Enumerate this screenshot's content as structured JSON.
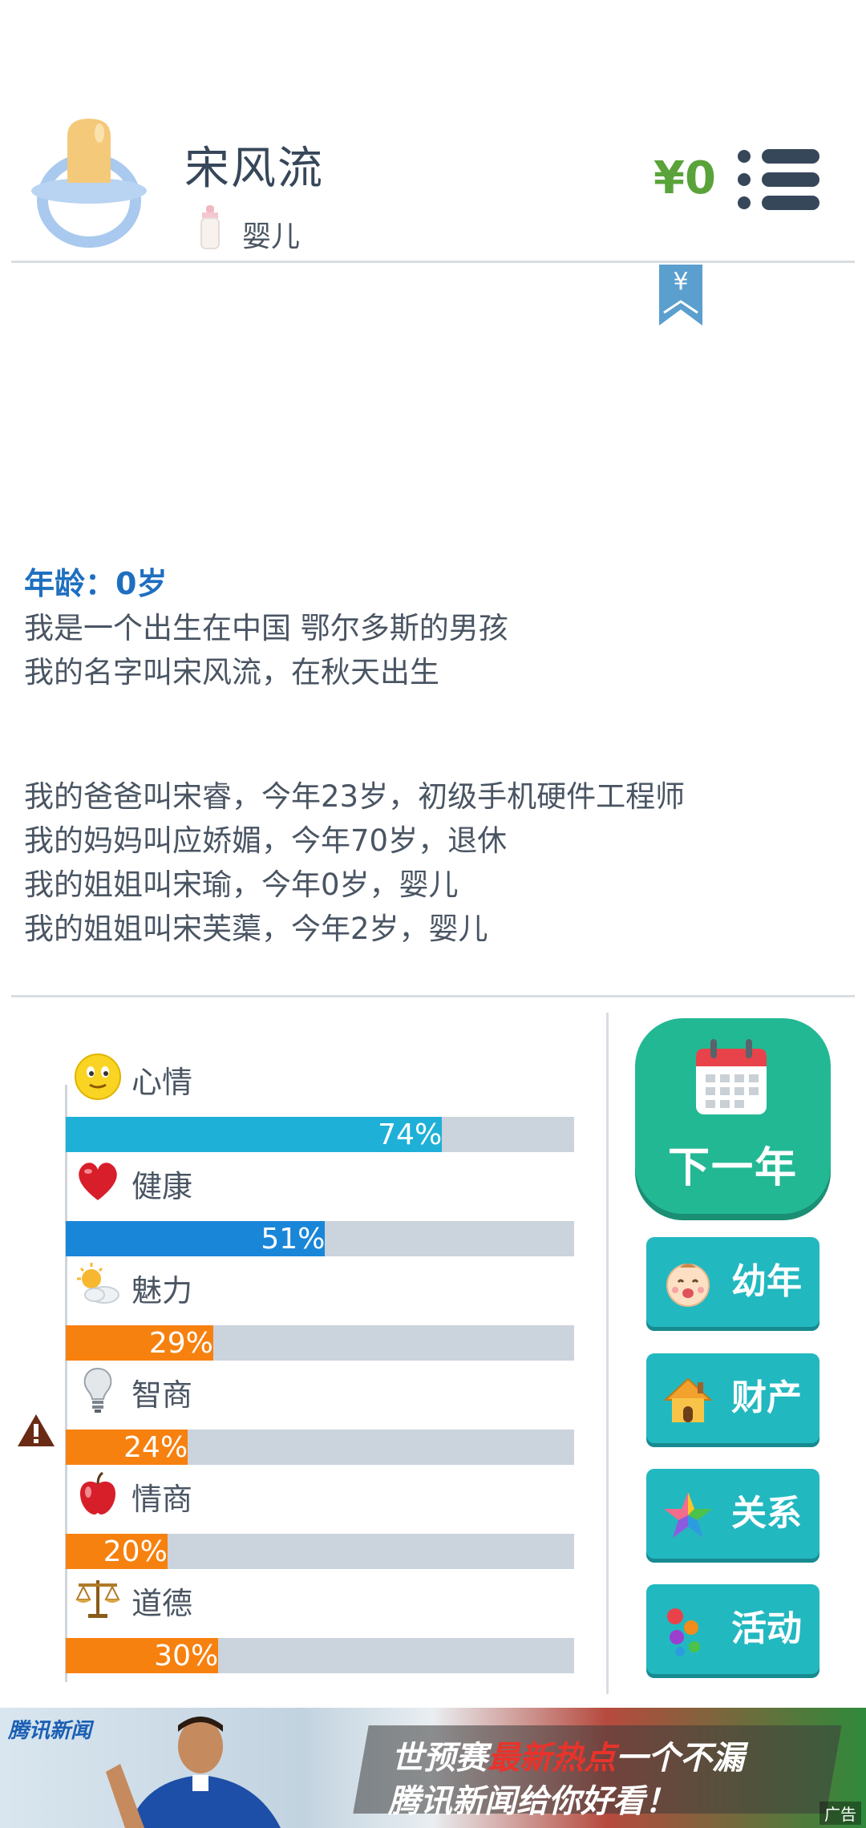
{
  "header": {
    "player_name": "宋风流",
    "stage": "婴儿",
    "money": "¥0",
    "bookmark_symbol": "¥"
  },
  "story": {
    "age_title": "年龄：0岁",
    "lines": [
      "我是一个出生在中国 鄂尔多斯的男孩",
      "我的名字叫宋风流，在秋天出生"
    ],
    "family": [
      "我的爸爸叫宋睿，今年23岁，初级手机硬件工程师",
      "我的妈妈叫应娇媚，今年70岁，退休",
      "我的姐姐叫宋瑜，今年0岁，婴儿",
      "我的姐姐叫宋芙蕖，今年2岁，婴儿"
    ]
  },
  "stats": [
    {
      "name": "心情",
      "value": 74,
      "label": "74%",
      "icon": "smiley-icon",
      "color": "#1fb0d8"
    },
    {
      "name": "健康",
      "value": 51,
      "label": "51%",
      "icon": "heart-icon",
      "color": "#1a86d8"
    },
    {
      "name": "魅力",
      "value": 29,
      "label": "29%",
      "icon": "sun-cloud-icon",
      "color": "#f7810f"
    },
    {
      "name": "智商",
      "value": 24,
      "label": "24%",
      "icon": "lightbulb-icon",
      "color": "#f7810f"
    },
    {
      "name": "情商",
      "value": 20,
      "label": "20%",
      "icon": "apple-icon",
      "color": "#f7810f"
    },
    {
      "name": "道德",
      "value": 30,
      "label": "30%",
      "icon": "scales-icon",
      "color": "#f7810f"
    }
  ],
  "actions": {
    "next_year": "下一年",
    "childhood": "幼年",
    "property": "财产",
    "relations": "关系",
    "activities": "活动"
  },
  "ad": {
    "logo": "腾讯新闻",
    "line1_a": "世预赛",
    "line1_hot": "最新热点",
    "line1_b": "一个不漏",
    "line2": "腾讯新闻给你好看！",
    "tag": "广告"
  }
}
